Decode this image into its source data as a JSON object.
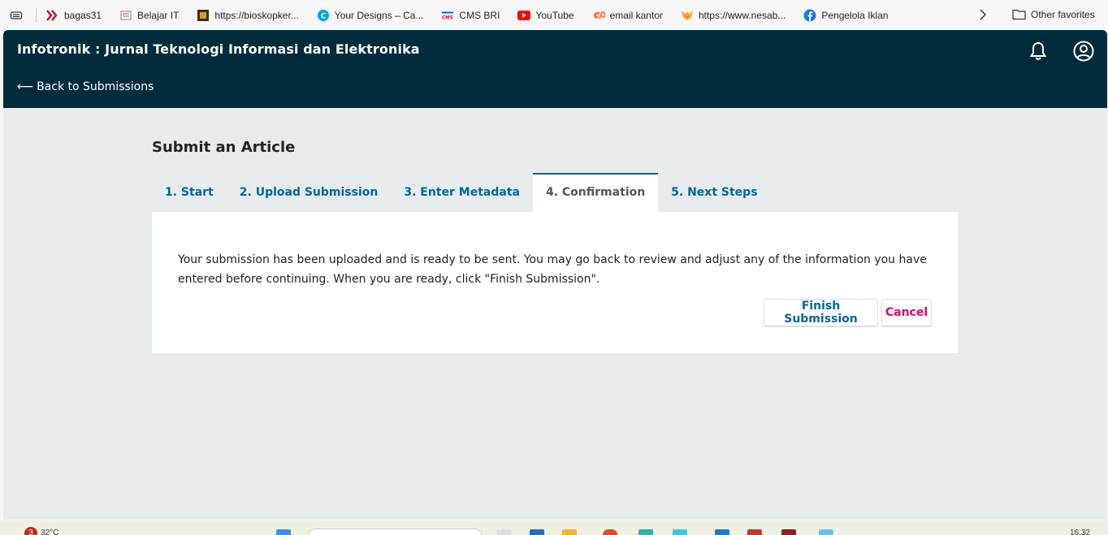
{
  "bookmarks": {
    "items": [
      {
        "label": "bagas31",
        "icon": "bagas31-icon",
        "color": "#c8102e"
      },
      {
        "label": "Belajar IT",
        "icon": "belajar-it-icon",
        "color": "#888888"
      },
      {
        "label": "https://bioskopker...",
        "icon": "bioskop-icon",
        "color": "#3a2a10"
      },
      {
        "label": "Your Designs – Ca...",
        "icon": "canva-icon",
        "color": "#00a3d9"
      },
      {
        "label": "CMS BRI",
        "icon": "cms-bri-icon",
        "color": "#00529c"
      },
      {
        "label": "YouTube",
        "icon": "youtube-icon",
        "color": "#ff0000"
      },
      {
        "label": "email kantor",
        "icon": "cpanel-icon",
        "color": "#ff6c2c"
      },
      {
        "label": "https://www.nesab...",
        "icon": "fox-icon",
        "color": "#f5a623"
      },
      {
        "label": "Pengelola Iklan",
        "icon": "facebook-icon",
        "color": "#1877f2"
      }
    ],
    "other_label": "Other favorites"
  },
  "header": {
    "title": "Infotronik : Jurnal Teknologi Informasi dan Elektronika",
    "back_arrow": "⟵",
    "back_label": "Back to Submissions"
  },
  "main": {
    "title": "Submit an Article",
    "tabs": [
      {
        "label": "1. Start"
      },
      {
        "label": "2. Upload Submission"
      },
      {
        "label": "3. Enter Metadata"
      },
      {
        "label": "4. Confirmation",
        "active": true
      },
      {
        "label": "5. Next Steps"
      }
    ],
    "message": "Your submission has been uploaded and is ready to be sent. You may go back to review and adjust any of the information you have entered before continuing. When you are ready, click \"Finish Submission\".",
    "finish_label": "Finish Submission",
    "cancel_label": "Cancel"
  },
  "taskbar": {
    "weather_badge": "3",
    "temperature": "32°C",
    "time": "16.32"
  },
  "colors": {
    "header_bg": "#002c3b",
    "content_bg": "#e8ebec",
    "link": "#006798",
    "cancel": "#d00a6c"
  }
}
